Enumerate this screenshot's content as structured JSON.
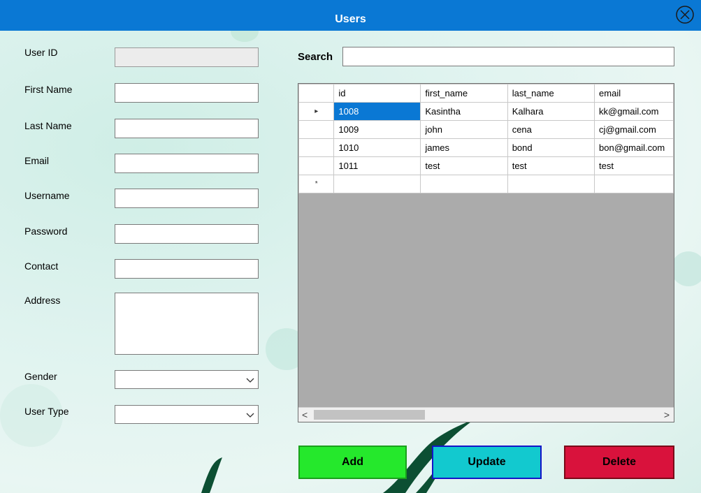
{
  "window": {
    "title": "Users",
    "close_icon": "close-circle-icon",
    "title_bar_color": "#0a78d4"
  },
  "form": {
    "user_id": {
      "label": "User ID",
      "value": ""
    },
    "first_name": {
      "label": "First Name",
      "value": ""
    },
    "last_name": {
      "label": "Last Name",
      "value": ""
    },
    "email": {
      "label": "Email",
      "value": ""
    },
    "username": {
      "label": "Username",
      "value": ""
    },
    "password": {
      "label": "Password",
      "value": ""
    },
    "contact": {
      "label": "Contact",
      "value": ""
    },
    "address": {
      "label": "Address",
      "value": ""
    },
    "gender": {
      "label": "Gender",
      "value": ""
    },
    "user_type": {
      "label": "User Type",
      "value": ""
    }
  },
  "search": {
    "label": "Search",
    "value": ""
  },
  "grid": {
    "columns": [
      "id",
      "first_name",
      "last_name",
      "email"
    ],
    "rows": [
      [
        "1008",
        "Kasintha",
        "Kalhara",
        "kk@gmail.com"
      ],
      [
        "1009",
        "john",
        "cena",
        "cj@gmail.com"
      ],
      [
        "1010",
        "james",
        "bond",
        "bon@gmail.com"
      ],
      [
        "1011",
        "test",
        "test",
        "test"
      ]
    ],
    "current_row_marker": "▸",
    "new_row_marker": "*",
    "selected_color": "#0a78d4"
  },
  "buttons": {
    "add": {
      "label": "Add",
      "color": "#25e82c"
    },
    "update": {
      "label": "Update",
      "color": "#12c9cf"
    },
    "delete": {
      "label": "Delete",
      "color": "#d9123c"
    }
  }
}
